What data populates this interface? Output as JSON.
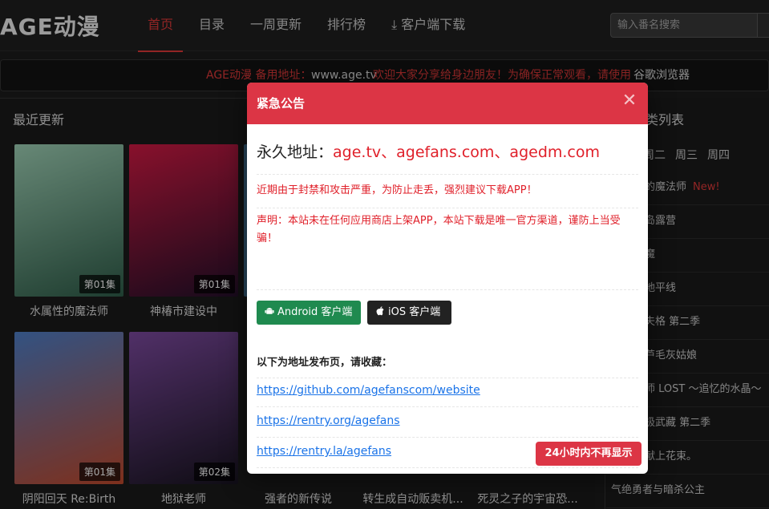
{
  "header": {
    "logo": "AGE动漫",
    "nav": [
      {
        "label": "首页",
        "active": true
      },
      {
        "label": "目录",
        "active": false
      },
      {
        "label": "一周更新",
        "active": false
      },
      {
        "label": "排行榜",
        "active": false
      },
      {
        "label": "客户端下载",
        "active": false
      }
    ],
    "search_placeholder": "输入番名搜索"
  },
  "notice": {
    "part1": "AGE动漫 备用地址：",
    "part2": "www.age.tv",
    "part3": "欢迎大家分享给身边朋友！为确保正常观看，请使用",
    "part4": "谷歌浏览器"
  },
  "recent": {
    "title": "最近更新",
    "cards": [
      {
        "title": "水属性的魔法师",
        "badge": "第01集",
        "color1": "#7fb79a",
        "color2": "#2f5e4a"
      },
      {
        "title": "神椿市建设中",
        "badge": "第01集",
        "color1": "#c0143a",
        "color2": "#2a0e2e"
      },
      {
        "title": "阴阳回天 Re:Birth",
        "badge": "第01集",
        "color1": "#3d6fb5",
        "color2": "#c24a2c"
      },
      {
        "title": "地狱老师",
        "badge": "第02集",
        "color1": "#6d3c8c",
        "color2": "#1a1624"
      },
      {
        "title": "强者的新传说",
        "badge": "",
        "color1": "#4a5e7a",
        "color2": "#1e2a3a"
      },
      {
        "title": "转生成自动贩卖机...",
        "badge": "",
        "color1": "#5c7a4a",
        "color2": "#232b1e"
      },
      {
        "title": "死灵之子的宇宙恐...",
        "badge": "",
        "color1": "#3a3a5c",
        "color2": "#15151f"
      }
    ]
  },
  "schedule": {
    "title": "类列表",
    "days": [
      "周二",
      "周三",
      "周四"
    ],
    "items": [
      {
        "label": "的魔法师",
        "new": "New!"
      },
      {
        "label": "岛露营",
        "new": ""
      },
      {
        "label": "魔",
        "new": ""
      },
      {
        "label": "地平线",
        "new": ""
      },
      {
        "label": "夫格 第二季",
        "new": ""
      },
      {
        "label": "芦毛灰姑娘",
        "new": ""
      },
      {
        "label": "师 LOST ～追忆的水晶～",
        "new": ""
      },
      {
        "label": "极武藏 第二季",
        "new": ""
      },
      {
        "label": "献上花束。",
        "new": ""
      },
      {
        "label": "气绝勇者与暗杀公主",
        "new": ""
      }
    ]
  },
  "modal": {
    "title": "紧急公告",
    "addr_prefix": "永久地址：",
    "addr_domains": "age.tv、agefans.com、agedm.com",
    "warning1": "近期由于封禁和攻击严重，为防止走丢，强烈建议下载APP！",
    "warning2": "声明：本站未在任何应用商店上架APP，本站下载是唯一官方渠道，谨防上当受骗！",
    "android_label": "Android 客户端",
    "ios_label": "iOS 客户端",
    "bookmark_label": "以下为地址发布页，请收藏：",
    "links": [
      "https://github.com/agefanscom/website",
      "https://rentry.org/agefans",
      "https://rentry.la/agefans"
    ],
    "dismiss_label": "24小时内不再显示"
  },
  "colors": {
    "accent": "#dc3545",
    "android": "#1f8a4f",
    "ios": "#222222",
    "link": "#1a73e8"
  }
}
